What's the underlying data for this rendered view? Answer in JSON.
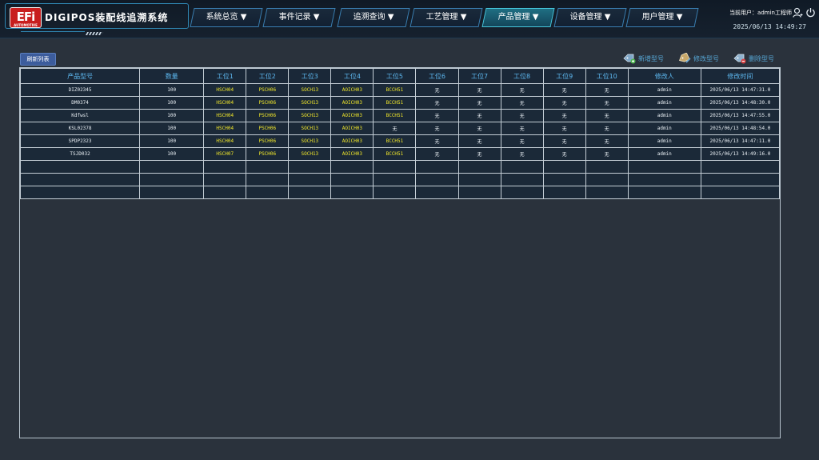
{
  "header": {
    "logo_text": "EFi",
    "logo_sub": "AUTOMOTIVE",
    "title": "DIGIPOS装配线追溯系统",
    "nav": [
      {
        "label": "系统总览 ▼"
      },
      {
        "label": "事件记录 ▼"
      },
      {
        "label": "追溯查询 ▼"
      },
      {
        "label": "工艺管理 ▼"
      },
      {
        "label": "产品管理 ▼"
      },
      {
        "label": "设备管理 ▼"
      },
      {
        "label": "用户管理 ▼"
      }
    ],
    "active_nav": 4,
    "user_label": "当前用户：admin工程师",
    "datetime": "2025/06/13 14:49:27",
    "colors": {
      "accent": "#46c7dd",
      "nav_border": "#3a7fb2",
      "brand_red": "#c81e1e"
    }
  },
  "toolbar": {
    "refresh_label": "刷新列表",
    "add_label": "新增型号",
    "edit_label": "修改型号",
    "delete_label": "删除型号",
    "icons": [
      "tag-add-icon",
      "tag-edit-icon",
      "tag-delete-icon"
    ]
  },
  "table": {
    "headers": [
      "产品型号",
      "数量",
      "工位1",
      "工位2",
      "工位3",
      "工位4",
      "工位5",
      "工位6",
      "工位7",
      "工位8",
      "工位9",
      "工位10",
      "修改人",
      "修改时间"
    ],
    "rows": [
      [
        "DIZ02345",
        "100",
        "HSCH04",
        "PSCH06",
        "SOCH13",
        "AOICH03",
        "BCCH51",
        "无",
        "无",
        "无",
        "无",
        "无",
        "admin",
        "2025/06/13 14:47:31.0"
      ],
      [
        "DM0374",
        "100",
        "HSCH04",
        "PSCH06",
        "SOCH13",
        "AOICH03",
        "BCCH51",
        "无",
        "无",
        "无",
        "无",
        "无",
        "admin",
        "2025/06/13 14:48:30.0"
      ],
      [
        "Kdfwsl",
        "100",
        "HSCH04",
        "PSCH06",
        "SOCH13",
        "AOICH03",
        "BCCH51",
        "无",
        "无",
        "无",
        "无",
        "无",
        "admin",
        "2025/06/13 14:47:55.0"
      ],
      [
        "KSL02378",
        "100",
        "HSCH04",
        "PSCH06",
        "SOCH13",
        "AOICH03",
        "无",
        "无",
        "无",
        "无",
        "无",
        "无",
        "admin",
        "2025/06/13 14:48:54.0"
      ],
      [
        "SPDP2323",
        "100",
        "HSCH04",
        "PSCH06",
        "SOCH13",
        "AOICH03",
        "BCCH51",
        "无",
        "无",
        "无",
        "无",
        "无",
        "admin",
        "2025/06/13 14:47:11.0"
      ],
      [
        "TSJD032",
        "100",
        "HSCH07",
        "PSCH06",
        "SOCH13",
        "AOICH03",
        "BCCH51",
        "无",
        "无",
        "无",
        "无",
        "无",
        "admin",
        "2025/06/13 14:49:16.0"
      ]
    ],
    "empty_rows": 3,
    "highlight_color": "#f0e62a"
  }
}
